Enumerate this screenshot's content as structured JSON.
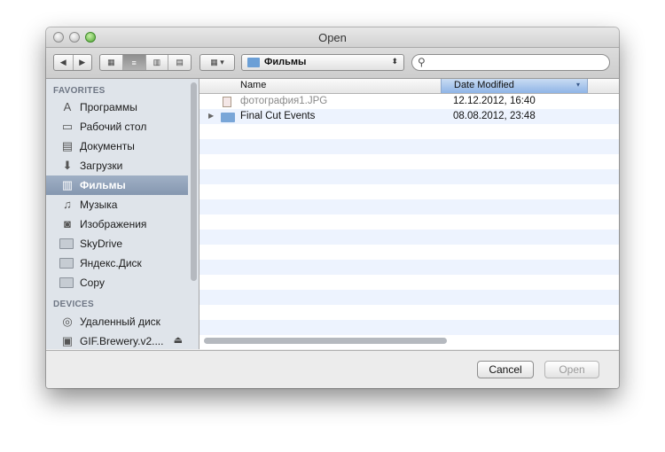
{
  "window": {
    "title": "Open"
  },
  "toolbar": {
    "back_glyph": "◀",
    "forward_glyph": "▶",
    "view_glyphs": [
      "▦",
      "≡",
      "▥",
      "▤"
    ],
    "arrange_glyph": "▦ ▾",
    "location": "Фильмы",
    "location_arrow": "⬍",
    "search_placeholder": ""
  },
  "sidebar": {
    "favorites_header": "FAVORITES",
    "favorites": [
      {
        "label": "Программы",
        "icon": "applications-icon",
        "glyph": "A"
      },
      {
        "label": "Рабочий стол",
        "icon": "desktop-icon",
        "glyph": "▭"
      },
      {
        "label": "Документы",
        "icon": "documents-icon",
        "glyph": "▤"
      },
      {
        "label": "Загрузки",
        "icon": "downloads-icon",
        "glyph": "⬇"
      },
      {
        "label": "Фильмы",
        "icon": "movies-icon",
        "glyph": "▥",
        "selected": true
      },
      {
        "label": "Музыка",
        "icon": "music-icon",
        "glyph": "♫"
      },
      {
        "label": "Изображения",
        "icon": "pictures-icon",
        "glyph": "◙"
      },
      {
        "label": "SkyDrive",
        "icon": "folder-icon"
      },
      {
        "label": "Яндекс.Диск",
        "icon": "folder-icon"
      },
      {
        "label": "Copy",
        "icon": "folder-icon"
      }
    ],
    "devices_header": "DEVICES",
    "devices": [
      {
        "label": "Удаленный диск",
        "icon": "remote-disc-icon",
        "glyph": "◎"
      },
      {
        "label": "GIF.Brewery.v2....",
        "icon": "disk-image-icon",
        "glyph": "▣",
        "eject": "⏏"
      }
    ]
  },
  "file_list": {
    "columns": {
      "name": "Name",
      "date": "Date Modified",
      "sort_arrow": "▾"
    },
    "rows": [
      {
        "name": "фотография1.JPG",
        "date": "12.12.2012, 16:40",
        "type": "file",
        "dim": true
      },
      {
        "name": "Final Cut Events",
        "date": "08.08.2012, 23:48",
        "type": "folder",
        "disclosure": "▶"
      }
    ]
  },
  "footer": {
    "cancel": "Cancel",
    "open": "Open"
  }
}
